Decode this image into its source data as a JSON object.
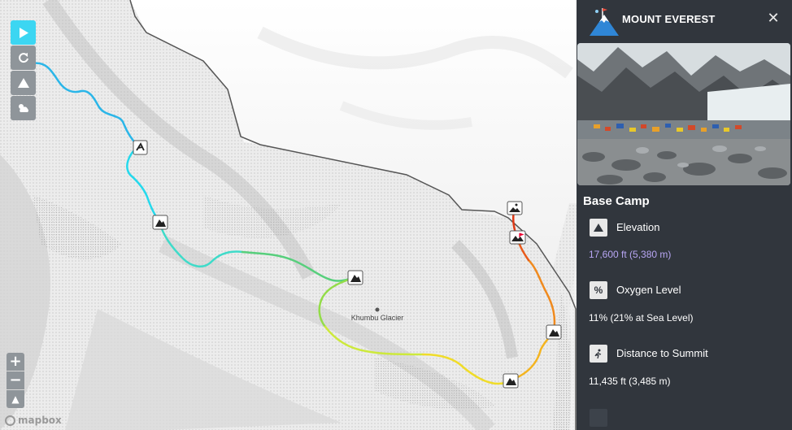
{
  "map": {
    "glacier_label": "Khumbu Glacier",
    "attribution": "mapbox",
    "route_colors": [
      "#2bb6e8",
      "#25d9ec",
      "#3fdbc9",
      "#57cf7c",
      "#93dc49",
      "#cde93c",
      "#f0dc29",
      "#f4b41f",
      "#f08a1e",
      "#e85a1b",
      "#df3a17"
    ]
  },
  "controls": {
    "play": {
      "icon": "play-icon",
      "active": true
    },
    "reset": {
      "icon": "reset-icon"
    },
    "terrain": {
      "icon": "mountain-icon"
    },
    "weather": {
      "icon": "weather-icon"
    },
    "zoom_in": "+",
    "zoom_out": "−",
    "compass": "▲"
  },
  "panel": {
    "title": "MOUNT EVEREST",
    "close": "✕",
    "location": "Base Camp",
    "stats": [
      {
        "icon": "mountain-icon",
        "label": "Elevation",
        "value": "17,600 ft (5,380 m)",
        "color": "#b8a6f4"
      },
      {
        "icon": "percent-icon",
        "label": "Oxygen Level",
        "value": "11% (21% at Sea Level)",
        "color": "#ffffff"
      },
      {
        "icon": "hiker-icon",
        "label": "Distance to Summit",
        "value": "11,435 ft (3,485 m)",
        "color": "#ffffff"
      }
    ]
  }
}
